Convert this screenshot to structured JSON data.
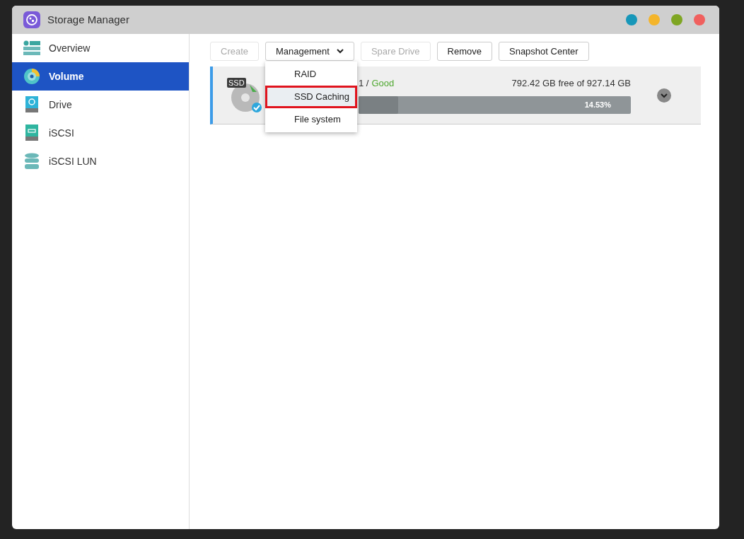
{
  "window": {
    "title": "Storage Manager",
    "controls": [
      {
        "color": "#1797b9"
      },
      {
        "color": "#f4b52b"
      },
      {
        "color": "#7fa623"
      },
      {
        "color": "#f0605e"
      }
    ]
  },
  "sidebar": {
    "items": [
      {
        "label": "Overview",
        "kind": "overview",
        "selected": false
      },
      {
        "label": "Volume",
        "kind": "volume",
        "selected": true
      },
      {
        "label": "Drive",
        "kind": "drive",
        "selected": false
      },
      {
        "label": "iSCSI",
        "kind": "iscsi",
        "selected": false
      },
      {
        "label": "iSCSI LUN",
        "kind": "lun",
        "selected": false
      }
    ]
  },
  "toolbar": {
    "buttons": [
      {
        "label": "Create",
        "disabled": true,
        "dropdown": false
      },
      {
        "label": "Management",
        "disabled": false,
        "dropdown": true
      },
      {
        "label": "Spare Drive",
        "disabled": true,
        "dropdown": false
      },
      {
        "label": "Remove",
        "disabled": false,
        "dropdown": false
      },
      {
        "label": "Snapshot Center",
        "disabled": false,
        "dropdown": false
      }
    ]
  },
  "menu": {
    "items": [
      {
        "label": "RAID",
        "highlighted": false
      },
      {
        "label": "SSD Caching",
        "highlighted": true
      },
      {
        "label": "File system",
        "highlighted": false
      }
    ]
  },
  "volume": {
    "badge": "SSD",
    "status_prefix": "1 /",
    "status": "Good",
    "capacity": "792.42 GB free of 927.14 GB",
    "level": 0.1453,
    "usage": "14.53%"
  }
}
